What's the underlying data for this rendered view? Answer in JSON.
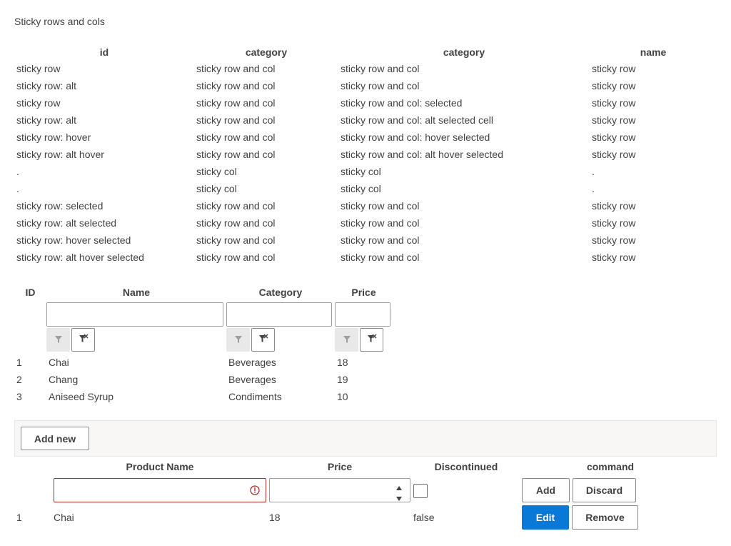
{
  "caption": "Sticky rows and cols",
  "sticky_table": {
    "headers": [
      "id",
      "category",
      "category",
      "name"
    ],
    "rows": [
      [
        "sticky row",
        "sticky row and col",
        "sticky row and col",
        "sticky row"
      ],
      [
        "sticky row: alt",
        "sticky row and col",
        "sticky row and col",
        "sticky row"
      ],
      [
        "sticky row",
        "sticky row and col",
        "sticky row and col: selected",
        "sticky row"
      ],
      [
        "sticky row: alt",
        "sticky row and col",
        "sticky row and col: alt selected cell",
        "sticky row"
      ],
      [
        "sticky row: hover",
        "sticky row and col",
        "sticky row and col: hover selected",
        "sticky row"
      ],
      [
        "sticky row: alt hover",
        "sticky row and col",
        "sticky row and col: alt hover selected",
        "sticky row"
      ],
      [
        ".",
        "sticky col",
        "sticky col",
        "."
      ],
      [
        ".",
        "sticky col",
        "sticky col",
        "."
      ],
      [
        "sticky row: selected",
        "sticky row and col",
        "sticky row and col",
        "sticky row"
      ],
      [
        "sticky row: alt selected",
        "sticky row and col",
        "sticky row and col",
        "sticky row"
      ],
      [
        "sticky row: hover selected",
        "sticky row and col",
        "sticky row and col",
        "sticky row"
      ],
      [
        "sticky row: alt hover selected",
        "sticky row and col",
        "sticky row and col",
        "sticky row"
      ]
    ]
  },
  "filter_grid": {
    "headers": [
      "ID",
      "Name",
      "Category",
      "Price"
    ],
    "rows": [
      [
        "1",
        "Chai",
        "Beverages",
        "18"
      ],
      [
        "2",
        "Chang",
        "Beverages",
        "19"
      ],
      [
        "3",
        "Aniseed Syrup",
        "Condiments",
        "10"
      ]
    ],
    "filter_icon": "funnel-icon",
    "clear_filter_icon": "filter-clear-icon"
  },
  "toolbar": {
    "add_new_label": "Add new"
  },
  "edit_grid": {
    "headers": {
      "product_name": "Product Name",
      "price": "Price",
      "discontinued": "Discontinued",
      "command": "command"
    },
    "add_label": "Add",
    "discard_label": "Discard",
    "row": {
      "id": "1",
      "name": "Chai",
      "price": "18",
      "discontinued": "false"
    },
    "edit_label": "Edit",
    "remove_label": "Remove",
    "error_icon": "error-icon"
  },
  "colors": {
    "primary": "#0a78d7",
    "error": "#b32c2c",
    "toolbar_bg": "#f8f7f6"
  }
}
